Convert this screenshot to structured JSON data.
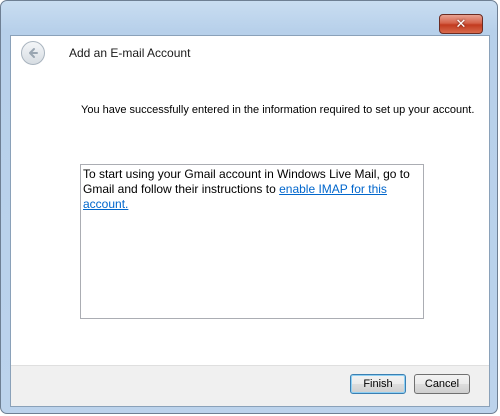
{
  "window": {
    "close_glyph": "✕",
    "title": "Add an E-mail Account"
  },
  "content": {
    "message": "You have successfully entered in the information required to set up your account.",
    "info_text": "To start using your Gmail account in Windows Live Mail, go to Gmail and follow their instructions to ",
    "info_link": "enable IMAP for this account."
  },
  "buttons": {
    "finish": "Finish",
    "cancel": "Cancel"
  },
  "icons": {
    "back": "back-arrow-icon",
    "close": "close-icon"
  }
}
